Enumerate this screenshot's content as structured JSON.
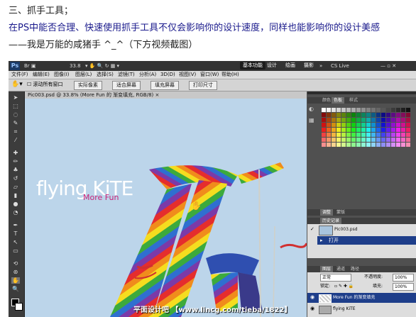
{
  "article": {
    "line1": "三、抓手工具；",
    "line2": "在PS中能否合理、快速使用抓手工具不仅会影响你的设计速度，同样也能影响你的设计美感",
    "line3": "——我是万能的咸猪手 ^_^（下方视频截图）"
  },
  "app": {
    "logo": "Ps",
    "zoom": "33.8",
    "workspace_buttons": [
      "基本功能",
      "设计",
      "绘画",
      "摄影"
    ],
    "cs_live": "CS Live"
  },
  "menu": [
    "文件(F)",
    "编辑(E)",
    "图像(I)",
    "图层(L)",
    "选择(S)",
    "滤镜(T)",
    "分析(A)",
    "3D(D)",
    "视图(V)",
    "窗口(W)",
    "帮助(H)"
  ],
  "options": {
    "checkbox_label": "滚动所有窗口",
    "buttons": [
      "实际像素",
      "适合屏幕",
      "填充屏幕",
      "打印尺寸"
    ]
  },
  "document": {
    "tab_title": "Pic003.psd @ 33.8% (More Fun 的 渐变填充, RGB/8) ×",
    "title_text": "flying KiTE",
    "subtitle_text": "More Fun"
  },
  "panels": {
    "color_tabs": [
      "颜色",
      "色板",
      "样式"
    ],
    "adjust_tabs": [
      "调整",
      "蒙版"
    ],
    "history_tab": "历史记录",
    "history_items": [
      "Pic003.psd",
      "打开"
    ],
    "layers_tabs": [
      "图层",
      "通道",
      "路径"
    ],
    "blend_mode": "正常",
    "opacity_label": "不透明度:",
    "opacity_value": "100%",
    "lock_label": "锁定:",
    "fill_label": "填充:",
    "fill_value": "100%",
    "layers": [
      "More Fun 的渐变填充",
      "flying KiTE"
    ]
  },
  "watermark": "平面设计吧 【www.lincg.com/tieba/1822】",
  "colors": {
    "app_bg": "#535353",
    "canvas_sky": "#bcd5ea",
    "selected_history": "#1e3e8a",
    "morefun": "#c82178"
  }
}
